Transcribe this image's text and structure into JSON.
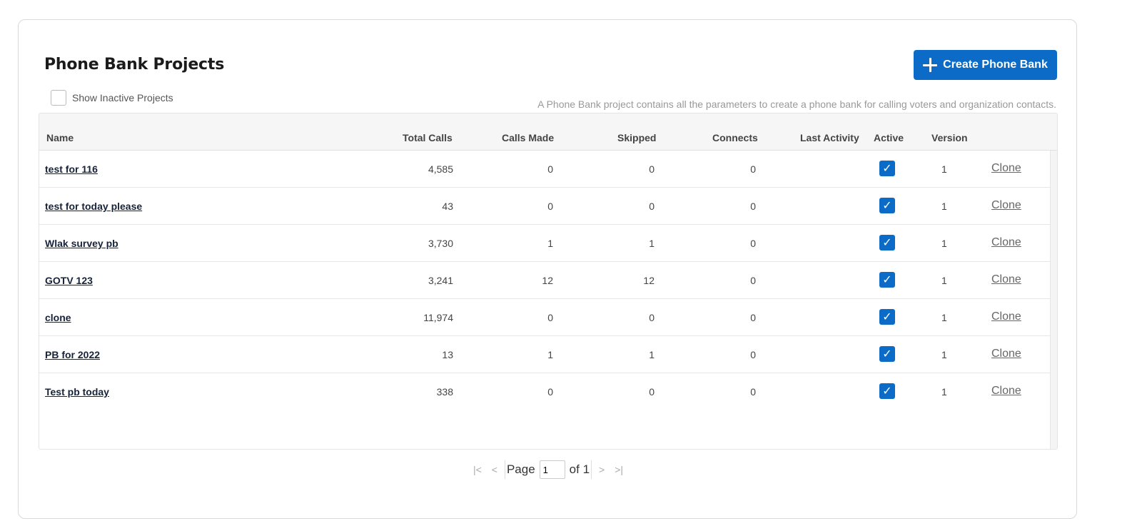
{
  "page": {
    "title": "Phone Bank Projects",
    "create_button_label": "Create Phone Bank",
    "show_inactive_label": "Show Inactive Projects",
    "show_inactive_checked": false,
    "description": "A Phone Bank project contains all the parameters to create a phone bank for calling voters and organization contacts."
  },
  "table": {
    "columns": {
      "name": "Name",
      "total_calls": "Total Calls",
      "calls_made": "Calls Made",
      "skipped": "Skipped",
      "connects": "Connects",
      "last_activity": "Last Activity",
      "active": "Active",
      "version": "Version"
    },
    "rows": [
      {
        "name": "test for 116",
        "total_calls": "4,585",
        "calls_made": "0",
        "skipped": "0",
        "connects": "0",
        "last_activity": "",
        "active": true,
        "version": "1",
        "action": "Clone"
      },
      {
        "name": "test for today please",
        "total_calls": "43",
        "calls_made": "0",
        "skipped": "0",
        "connects": "0",
        "last_activity": "",
        "active": true,
        "version": "1",
        "action": "Clone"
      },
      {
        "name": "Wlak survey pb",
        "total_calls": "3,730",
        "calls_made": "1",
        "skipped": "1",
        "connects": "0",
        "last_activity": "",
        "active": true,
        "version": "1",
        "action": "Clone"
      },
      {
        "name": "GOTV 123",
        "total_calls": "3,241",
        "calls_made": "12",
        "skipped": "12",
        "connects": "0",
        "last_activity": "",
        "active": true,
        "version": "1",
        "action": "Clone"
      },
      {
        "name": "clone",
        "total_calls": "11,974",
        "calls_made": "0",
        "skipped": "0",
        "connects": "0",
        "last_activity": "",
        "active": true,
        "version": "1",
        "action": "Clone"
      },
      {
        "name": "PB for 2022",
        "total_calls": "13",
        "calls_made": "1",
        "skipped": "1",
        "connects": "0",
        "last_activity": "",
        "active": true,
        "version": "1",
        "action": "Clone"
      },
      {
        "name": "Test pb today",
        "total_calls": "338",
        "calls_made": "0",
        "skipped": "0",
        "connects": "0",
        "last_activity": "",
        "active": true,
        "version": "1",
        "action": "Clone"
      }
    ]
  },
  "pager": {
    "page_label": "Page",
    "current_page": "1",
    "of_label": "of 1",
    "first_icon": "first-page-icon",
    "prev_icon": "prev-page-icon",
    "next_icon": "next-page-icon",
    "last_icon": "last-page-icon"
  },
  "colors": {
    "accent": "#0b6bc7"
  }
}
